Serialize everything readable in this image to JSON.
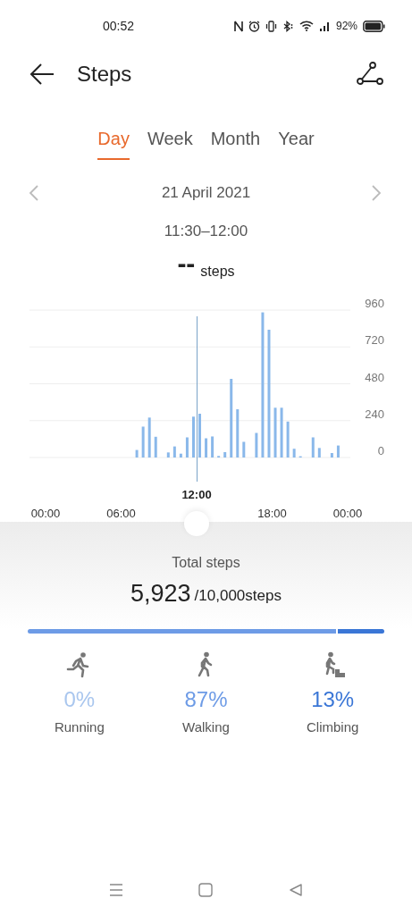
{
  "status_bar": {
    "time": "00:52",
    "battery": "92%"
  },
  "header": {
    "title": "Steps"
  },
  "tabs": [
    {
      "label": "Day",
      "selected": true
    },
    {
      "label": "Week",
      "selected": false
    },
    {
      "label": "Month",
      "selected": false
    },
    {
      "label": "Year",
      "selected": false
    }
  ],
  "date": "21 April 2021",
  "time_range": "11:30–12:00",
  "reading": {
    "value": "--",
    "unit": "steps"
  },
  "chart_data": {
    "type": "bar",
    "x": [
      7.25,
      7.75,
      8.25,
      8.75,
      9.75,
      10.25,
      10.75,
      11.25,
      11.75,
      12.25,
      12.75,
      13.25,
      13.75,
      14.25,
      14.75,
      15.25,
      15.75,
      16.75,
      17.25,
      17.75,
      18.25,
      18.75,
      19.25,
      19.75,
      20.25,
      21.25,
      21.75,
      22.75,
      23.25
    ],
    "series": [
      {
        "color": "#8ab8ea",
        "values": [
          49,
          201,
          260,
          135,
          33,
          72,
          25,
          131,
          266,
          285,
          125,
          137,
          10,
          35,
          512,
          314,
          102,
          160,
          945,
          832,
          324,
          324,
          234,
          57,
          8,
          131,
          62,
          29,
          78
        ]
      }
    ],
    "xlim": [
      0,
      24
    ],
    "ylim": [
      0,
      960
    ],
    "xticks": [
      {
        "value": 0,
        "label": "00:00"
      },
      {
        "value": 6,
        "label": "06:00"
      },
      {
        "value": 18,
        "label": "18:00"
      },
      {
        "value": 24,
        "label": "00:00"
      }
    ],
    "yticks": [
      0,
      240,
      480,
      720,
      960
    ],
    "grid": true
  },
  "selected_time": "12:00",
  "total": {
    "label": "Total steps",
    "value": "5,923",
    "goal": "/10,000steps"
  },
  "activities": [
    {
      "kind": "running",
      "label": "Running",
      "percent": "0%",
      "color": "#a9c6ee"
    },
    {
      "kind": "walking",
      "label": "Walking",
      "percent": "87%",
      "color": "#6d9be6"
    },
    {
      "kind": "climbing",
      "label": "Climbing",
      "percent": "13%",
      "color": "#3a76d6"
    }
  ]
}
